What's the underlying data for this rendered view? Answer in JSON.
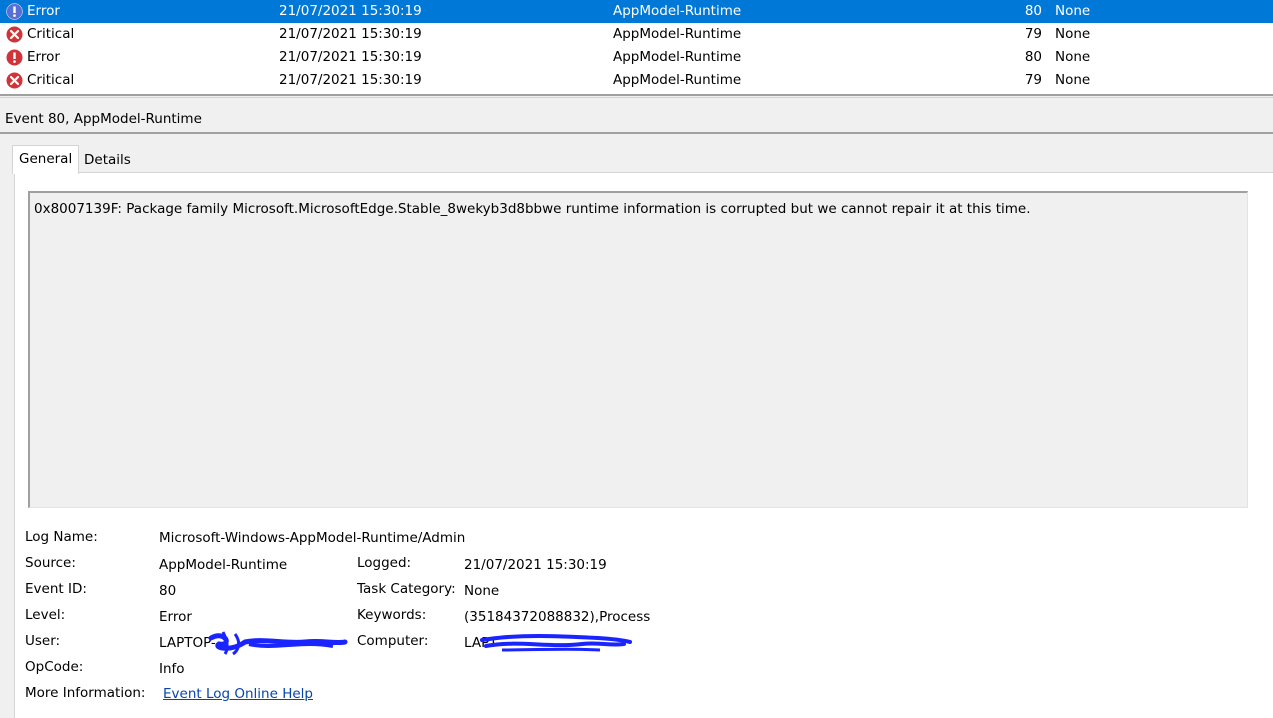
{
  "events": [
    {
      "level": "Error",
      "icon": "error-info-icon",
      "date": "21/07/2021 15:30:19",
      "source": "AppModel-Runtime",
      "event_id": "80",
      "task": "None",
      "selected": true
    },
    {
      "level": "Critical",
      "icon": "critical-icon",
      "date": "21/07/2021 15:30:19",
      "source": "AppModel-Runtime",
      "event_id": "79",
      "task": "None"
    },
    {
      "level": "Error",
      "icon": "error-icon",
      "date": "21/07/2021 15:30:19",
      "source": "AppModel-Runtime",
      "event_id": "80",
      "task": "None"
    },
    {
      "level": "Critical",
      "icon": "critical-icon",
      "date": "21/07/2021 15:30:19",
      "source": "AppModel-Runtime",
      "event_id": "79",
      "task": "None"
    }
  ],
  "detail": {
    "title": "Event 80, AppModel-Runtime",
    "tabs": {
      "general": "General",
      "details": "Details"
    },
    "message": "0x8007139F: Package family Microsoft.MicrosoftEdge.Stable_8wekyb3d8bbwe runtime information is corrupted but we cannot repair it at this time.",
    "labels": {
      "log_name": "Log Name:",
      "source": "Source:",
      "event_id": "Event ID:",
      "level": "Level:",
      "user": "User:",
      "opcode": "OpCode:",
      "more_info": "More Information:",
      "logged": "Logged:",
      "task_category": "Task Category:",
      "keywords": "Keywords:",
      "computer": "Computer:"
    },
    "values": {
      "log_name": "Microsoft-Windows-AppModel-Runtime/Admin",
      "source": "AppModel-Runtime",
      "event_id": "80",
      "level": "Error",
      "user": "LAPTOP-",
      "opcode": "Info",
      "more_info": "Event Log Online Help",
      "logged": "21/07/2021 15:30:19",
      "task_category": "None",
      "keywords": "(35184372088832),Process",
      "computer": "LAPT"
    }
  },
  "colors": {
    "selection": "#0078d7",
    "error": "#d13438",
    "critical": "#d13438",
    "redaction": "#1a24ff",
    "link": "#0645ad"
  }
}
